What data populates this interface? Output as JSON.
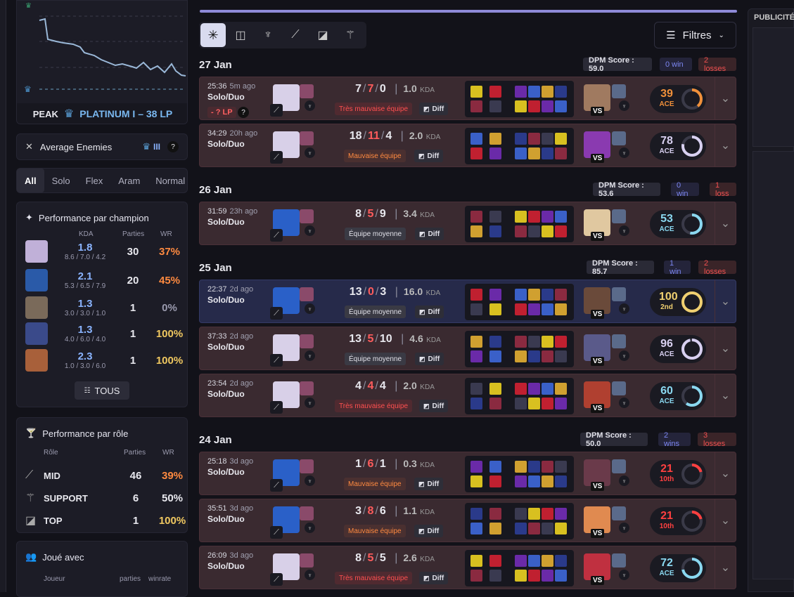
{
  "peak": {
    "label": "PEAK",
    "rank": "PLATINUM I – 38 LP"
  },
  "average_enemies": {
    "label": "Average Enemies",
    "value": "III",
    "help": "?"
  },
  "queue_tabs": [
    "All",
    "Solo",
    "Flex",
    "Aram",
    "Normal"
  ],
  "champion_perf": {
    "title": "Performance par champion",
    "headers": {
      "kda": "KDA",
      "games": "Parties",
      "wr": "WR"
    },
    "rows": [
      {
        "kda": "1.8",
        "detail": "8.6 / 7.0 / 4.2",
        "games": "30",
        "wr": "37%",
        "wr_color": "#ff8a40"
      },
      {
        "kda": "2.1",
        "detail": "5.3 / 6.5 / 7.9",
        "games": "20",
        "wr": "45%",
        "wr_color": "#ff8a40"
      },
      {
        "kda": "1.3",
        "detail": "3.0 / 3.0 / 1.0",
        "games": "1",
        "wr": "0%",
        "wr_color": "#9a9aae"
      },
      {
        "kda": "1.3",
        "detail": "4.0 / 6.0 / 4.0",
        "games": "1",
        "wr": "100%",
        "wr_color": "#f0c860"
      },
      {
        "kda": "2.3",
        "detail": "1.0 / 3.0 / 6.0",
        "games": "1",
        "wr": "100%",
        "wr_color": "#f0c860"
      }
    ],
    "all_button": "TOUS"
  },
  "role_perf": {
    "title": "Performance par rôle",
    "headers": {
      "role": "Rôle",
      "games": "Parties",
      "wr": "WR"
    },
    "rows": [
      {
        "role": "MID",
        "games": "46",
        "wr": "39%",
        "wr_color": "#ff8a40"
      },
      {
        "role": "SUPPORT",
        "games": "6",
        "wr": "50%",
        "wr_color": "#e8e8ee"
      },
      {
        "role": "TOP",
        "games": "1",
        "wr": "100%",
        "wr_color": "#f0c860"
      }
    ]
  },
  "played_with": {
    "title": "Joué avec",
    "headers": {
      "player": "Joueur",
      "games": "parties",
      "wr": "winrate"
    }
  },
  "filters_label": "Filtres",
  "publicite": "PUBLICITÉ",
  "days": [
    {
      "date": "27 Jan",
      "dpm": "DPM Score : 59.0",
      "wins": "0 win",
      "losses": "2 losses"
    },
    {
      "date": "26 Jan",
      "dpm": "DPM Score : 53.6",
      "wins": "0 win",
      "losses": "1 loss"
    },
    {
      "date": "25 Jan",
      "dpm": "DPM Score : 85.7",
      "wins": "1 win",
      "losses": "2 losses"
    },
    {
      "date": "24 Jan",
      "dpm": "DPM Score : 50.0",
      "wins": "2 wins",
      "losses": "3 losses"
    }
  ],
  "games": [
    {
      "time": "25:36",
      "ago": "5m ago",
      "mode": "Solo/Duo",
      "lp": "- ? LP",
      "k": "7",
      "d": "7",
      "a": "0",
      "ratio": "1.0",
      "team": "Très mauvaise équipe",
      "team_type": "bad",
      "diff": "Diff",
      "score": "39",
      "score_lab": "ACE",
      "score_pct": 0.39,
      "score_color": "#f0903a",
      "win": false
    },
    {
      "time": "34:29",
      "ago": "20h ago",
      "mode": "Solo/Duo",
      "k": "18",
      "d": "11",
      "a": "4",
      "ratio": "2.0",
      "team": "Mauvaise équipe",
      "team_type": "mbad",
      "diff": "Diff",
      "score": "78",
      "score_lab": "ACE",
      "score_pct": 0.78,
      "score_color": "#d8d0f0",
      "win": false
    },
    {
      "time": "31:59",
      "ago": "23h ago",
      "mode": "Solo/Duo",
      "k": "8",
      "d": "5",
      "a": "9",
      "ratio": "3.4",
      "team": "Équipe moyenne",
      "team_type": "mid",
      "diff": "Diff",
      "score": "53",
      "score_lab": "ACE",
      "score_pct": 0.53,
      "score_color": "#8ad8f0",
      "win": false
    },
    {
      "time": "22:37",
      "ago": "2d ago",
      "mode": "Solo/Duo",
      "k": "13",
      "d": "0",
      "a": "3",
      "ratio": "16.0",
      "team": "Équipe moyenne",
      "team_type": "mid",
      "diff": "Diff",
      "score": "100",
      "score_lab": "2nd",
      "score_pct": 1.0,
      "score_color": "#f0d070",
      "win": true
    },
    {
      "time": "37:33",
      "ago": "2d ago",
      "mode": "Solo/Duo",
      "k": "13",
      "d": "5",
      "a": "10",
      "ratio": "4.6",
      "team": "Équipe moyenne",
      "team_type": "mid",
      "diff": "Diff",
      "score": "96",
      "score_lab": "ACE",
      "score_pct": 0.96,
      "score_color": "#d8d0f0",
      "win": false
    },
    {
      "time": "23:54",
      "ago": "2d ago",
      "mode": "Solo/Duo",
      "k": "4",
      "d": "4",
      "a": "4",
      "ratio": "2.0",
      "team": "Très mauvaise équipe",
      "team_type": "bad",
      "diff": "Diff",
      "score": "60",
      "score_lab": "ACE",
      "score_pct": 0.6,
      "score_color": "#8ad8f0",
      "win": false
    },
    {
      "time": "25:18",
      "ago": "3d ago",
      "mode": "Solo/Duo",
      "k": "1",
      "d": "6",
      "a": "1",
      "ratio": "0.3",
      "team": "Mauvaise équipe",
      "team_type": "mbad",
      "diff": "Diff",
      "score": "21",
      "score_lab": "10th",
      "score_pct": 0.21,
      "score_color": "#ff4040",
      "win": false
    },
    {
      "time": "35:51",
      "ago": "3d ago",
      "mode": "Solo/Duo",
      "k": "3",
      "d": "8",
      "a": "6",
      "ratio": "1.1",
      "team": "Mauvaise équipe",
      "team_type": "mbad",
      "diff": "Diff",
      "score": "21",
      "score_lab": "10th",
      "score_pct": 0.21,
      "score_color": "#ff4040",
      "win": false
    },
    {
      "time": "26:09",
      "ago": "3d ago",
      "mode": "Solo/Duo",
      "k": "8",
      "d": "5",
      "a": "5",
      "ratio": "2.6",
      "team": "Très mauvaise équipe",
      "team_type": "bad",
      "diff": "Diff",
      "score": "72",
      "score_lab": "ACE",
      "score_pct": 0.72,
      "score_color": "#8ad8f0",
      "win": false
    }
  ],
  "kda_label": "KDA",
  "vs_label": "VS"
}
